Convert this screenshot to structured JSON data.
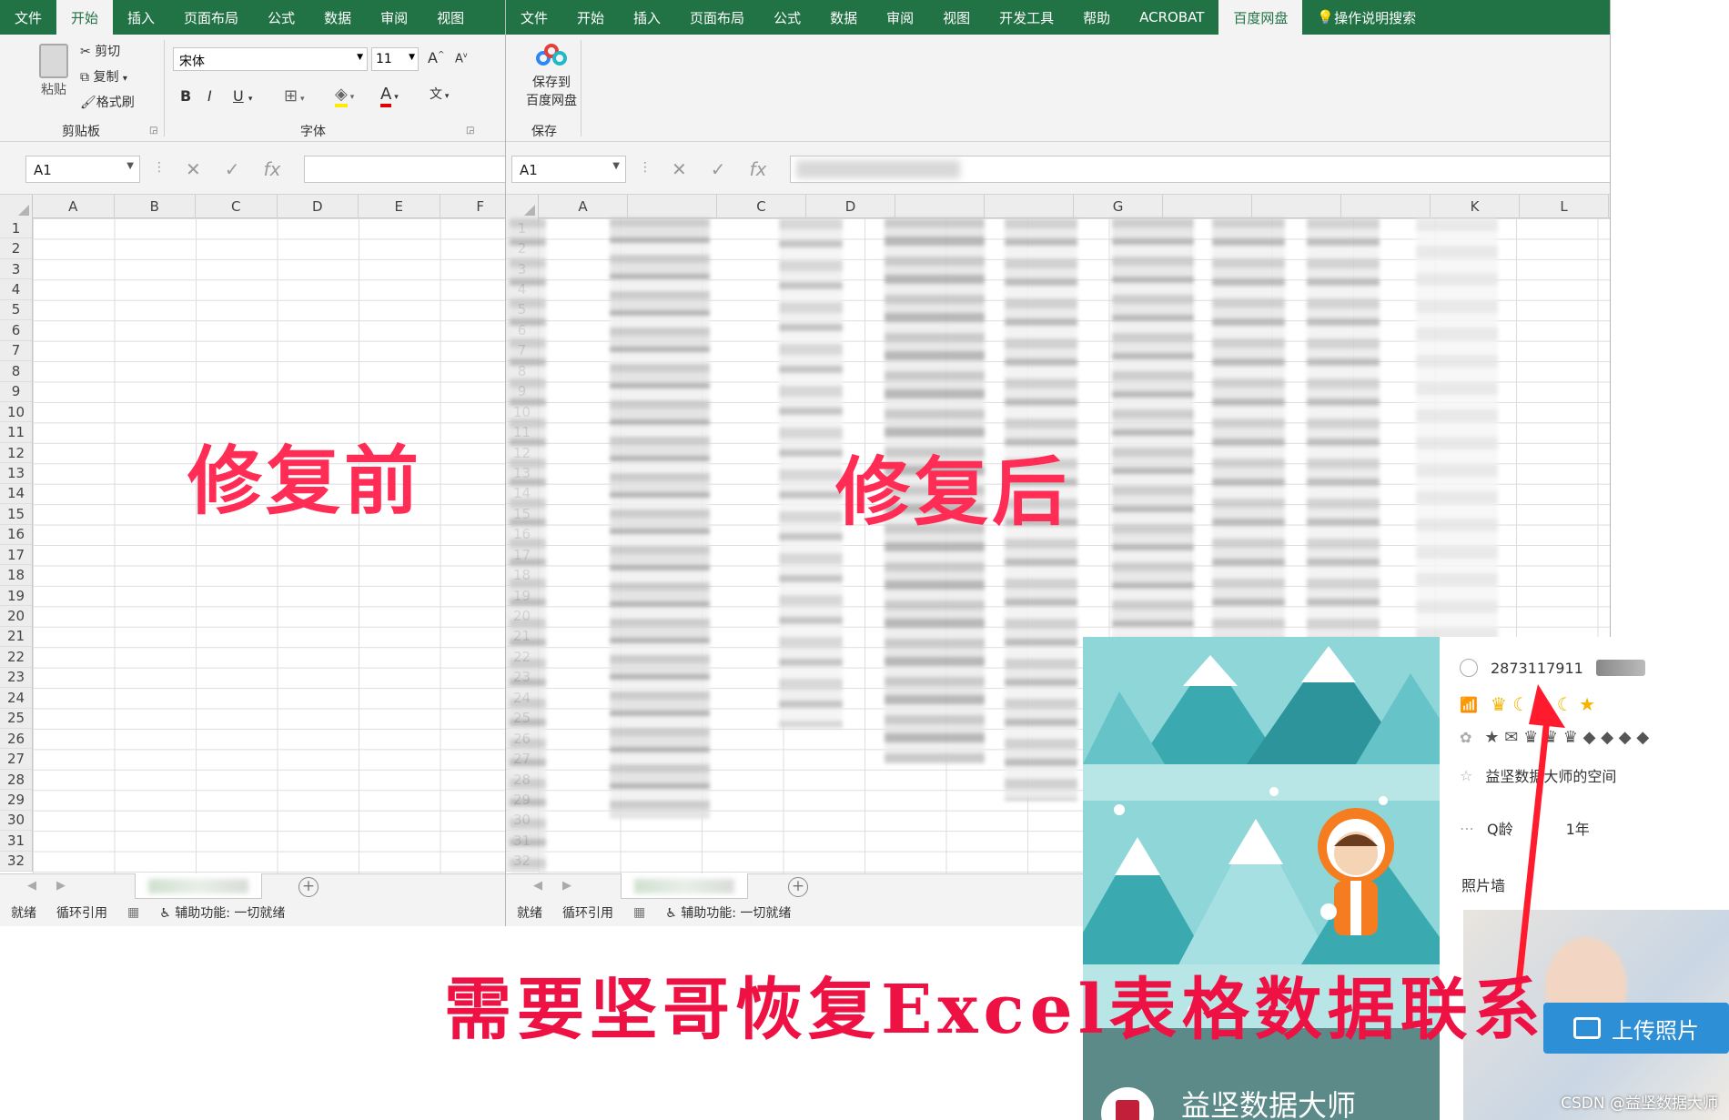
{
  "left_excel": {
    "menu": [
      "文件",
      "开始",
      "插入",
      "页面布局",
      "公式",
      "数据",
      "审阅",
      "视图"
    ],
    "active_tab": "开始",
    "clipboard": {
      "paste": "粘贴",
      "cut": "剪切",
      "copy": "复制",
      "format_painter": "格式刷",
      "group_label": "剪贴板"
    },
    "font": {
      "name": "宋体",
      "size": "11",
      "bold": "B",
      "italic": "I",
      "underline": "U",
      "group_label": "字体"
    },
    "namebox": "A1",
    "columns": [
      "A",
      "B",
      "C",
      "D",
      "E",
      "F"
    ],
    "status": {
      "ready": "就绪",
      "circular": "循环引用",
      "accessibility": "辅助功能: 一切就绪"
    },
    "label": "修复前"
  },
  "right_excel": {
    "menu": [
      "文件",
      "开始",
      "插入",
      "页面布局",
      "公式",
      "数据",
      "审阅",
      "视图",
      "开发工具",
      "帮助",
      "ACROBAT",
      "百度网盘"
    ],
    "active_tab": "百度网盘",
    "tell_me": "操作说明搜索",
    "save": {
      "line1": "保存到",
      "line2": "百度网盘",
      "group_label": "保存"
    },
    "namebox": "A1",
    "columns": [
      "A",
      "",
      "C",
      "D",
      "",
      "",
      "G",
      "",
      "",
      "",
      "K",
      "L"
    ],
    "status": {
      "ready": "就绪",
      "circular": "循环引用",
      "accessibility": "辅助功能: 一切就绪"
    },
    "label": "修复后"
  },
  "rows": [
    "1",
    "2",
    "3",
    "4",
    "5",
    "6",
    "7",
    "8",
    "9",
    "10",
    "11",
    "12",
    "13",
    "14",
    "15",
    "16",
    "17",
    "18",
    "19",
    "20",
    "21",
    "22",
    "23",
    "24",
    "25",
    "26",
    "27",
    "28",
    "29",
    "30",
    "31",
    "32"
  ],
  "qq": {
    "number": "2873117911",
    "space": "益坚数据大师的空间",
    "qage_label": "Q龄",
    "qage_value": "1年",
    "photo_wall": "照片墙",
    "upload": "上传照片",
    "name": "益坚数据大师"
  },
  "caption": "需要坚哥恢复Excel表格数据联系",
  "watermark": "CSDN @益坚数据大师",
  "colors": {
    "excel_green": "#217346",
    "label_red": "#ff2d55",
    "upload_blue": "#2d8fd6"
  }
}
